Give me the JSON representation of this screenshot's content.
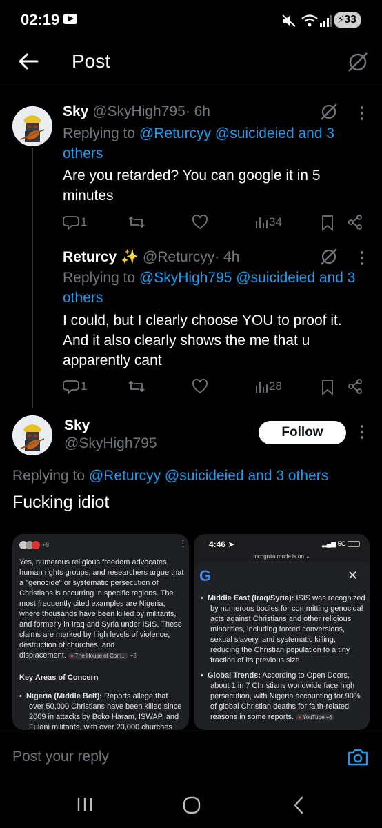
{
  "status": {
    "time": "02:19",
    "battery": "33"
  },
  "header": {
    "title": "Post"
  },
  "tweets": [
    {
      "name": "Sky",
      "handle": "@SkyHigh795",
      "time": "· 6h",
      "replying_prefix": "Replying to",
      "replying_line1": "@Returcyy @suicideied and 3",
      "replying_line2": "others",
      "text_line1": "Are you retarded? You can google it in 5",
      "text_line2": "minutes",
      "replies": "1",
      "views": "34"
    },
    {
      "name": "Returcy ✨",
      "handle": "@Returcyy",
      "time": "· 4h",
      "replying_prefix": "Replying to",
      "replying_line1": "@SkyHigh795 @suicideied and 3",
      "replying_line2": "others",
      "text_line1": "I could, but I clearly choose YOU to proof it.",
      "text_line2": "And it also clearly shows the me that u",
      "text_line3": "apparently cant",
      "replies": "1",
      "views": "28"
    }
  ],
  "main": {
    "name": "Sky",
    "handle": "@SkyHigh795",
    "follow_label": "Follow",
    "replying_prefix": "Replying to",
    "replying_links": "@Returcyy @suicideied and 3 others",
    "text": "Fucking idiot"
  },
  "left_image": {
    "badge": "+8",
    "lines": [
      "Yes, numerous religious freedom advocates,",
      "human rights groups, and researchers argue that",
      "a \"genocide\" or systematic persecution of",
      "Christians is occurring in specific regions. The",
      "most frequently cited examples are Nigeria,",
      "where thousands have been killed by militants,",
      "and formerly in Iraq and Syria under ISIS. These",
      "claims are marked by high levels of violence,",
      "destruction of churches, and"
    ],
    "last_line": "displacement.",
    "source_chip": "The House of Com...",
    "source_more": "+3",
    "section_heading": "Key Areas of Concern",
    "bullet_label": "Nigeria (Middle Belt):",
    "bullet_text_first": " Reports allege that",
    "bullet_lines": [
      "over 50,000 Christians have been killed since",
      "2009 in attacks by Boko Haram, ISWAP, and",
      "Fulani militants, with over 20,000 churches"
    ]
  },
  "right_image": {
    "time": "4:46",
    "network": "5G",
    "incognito": "Incognito mode is on",
    "bullet1_label": "Middle East (Iraq/Syria):",
    "bullet1_first": " ISIS was recognized",
    "bullet1_lines": [
      "by numerous bodies for committing genocidal",
      "acts against Christians and other religious",
      "minorities, including forced conversions,",
      "sexual slavery, and systematic killing,",
      "reducing the Christian population to a tiny",
      "fraction of its previous size."
    ],
    "bullet2_label": "Global Trends:",
    "bullet2_first": " According to Open Doors,",
    "bullet2_lines": [
      "about 1 in 7 Christians worldwide face high",
      "persecution, with Nigeria accounting for 90%",
      "of global Christian deaths for faith-related"
    ],
    "bullet2_last": "reasons in some reports.",
    "source_chip": "YouTube +6"
  },
  "reply_bar": {
    "placeholder": "Post your reply"
  }
}
